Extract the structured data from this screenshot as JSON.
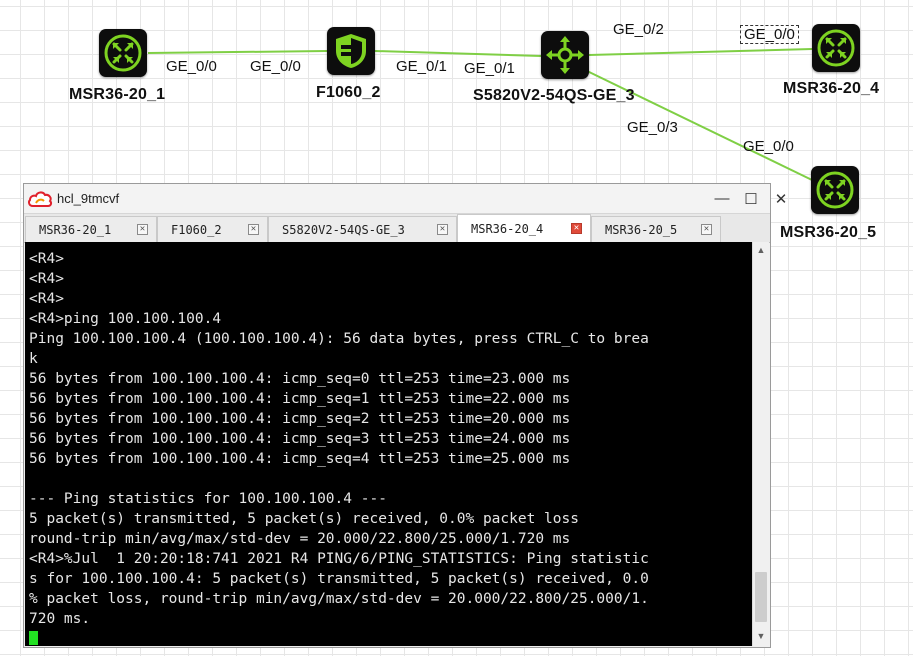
{
  "topology": {
    "devices": {
      "msr1": {
        "label": "MSR36-20_1",
        "icon": "router-icon"
      },
      "fw": {
        "label": "F1060_2",
        "icon": "firewall-shield-icon"
      },
      "sw": {
        "label": "S5820V2-54QS-GE_3",
        "icon": "switch-arrows-icon"
      },
      "msr4": {
        "label": "MSR36-20_4",
        "icon": "router-icon"
      },
      "msr5": {
        "label": "MSR36-20_5",
        "icon": "router-icon"
      }
    },
    "ports": {
      "msr1_fw": "GE_0/0",
      "fw_msr1": "GE_0/0",
      "fw_sw": "GE_0/1",
      "sw_fw": "GE_0/1",
      "sw_msr4": "GE_0/2",
      "msr4_sw": "GE_0/0",
      "sw_msr5": "GE_0/3",
      "msr5_sw": "GE_0/0"
    },
    "link_color": "#7fcf45",
    "icon_color": "#7ed321"
  },
  "window": {
    "title": "hcl_9tmcvf",
    "controls": {
      "minimize": "—",
      "maximize": "☐",
      "close": "✕"
    },
    "tabs": [
      {
        "label": "MSR36-20_1",
        "active": false
      },
      {
        "label": "F1060_2",
        "active": false
      },
      {
        "label": "S5820V2-54QS-GE_3",
        "active": false
      },
      {
        "label": "MSR36-20_4",
        "active": true
      },
      {
        "label": "MSR36-20_5",
        "active": false
      }
    ],
    "terminal_lines": [
      "<R4>",
      "<R4>",
      "<R4>",
      "<R4>ping 100.100.100.4",
      "Ping 100.100.100.4 (100.100.100.4): 56 data bytes, press CTRL_C to brea",
      "k",
      "56 bytes from 100.100.100.4: icmp_seq=0 ttl=253 time=23.000 ms",
      "56 bytes from 100.100.100.4: icmp_seq=1 ttl=253 time=22.000 ms",
      "56 bytes from 100.100.100.4: icmp_seq=2 ttl=253 time=20.000 ms",
      "56 bytes from 100.100.100.4: icmp_seq=3 ttl=253 time=24.000 ms",
      "56 bytes from 100.100.100.4: icmp_seq=4 ttl=253 time=25.000 ms",
      "",
      "--- Ping statistics for 100.100.100.4 ---",
      "5 packet(s) transmitted, 5 packet(s) received, 0.0% packet loss",
      "round-trip min/avg/max/std-dev = 20.000/22.800/25.000/1.720 ms",
      "<R4>%Jul  1 20:20:18:741 2021 R4 PING/6/PING_STATISTICS: Ping statistic",
      "s for 100.100.100.4: 5 packet(s) transmitted, 5 packet(s) received, 0.0",
      "% packet loss, round-trip min/avg/max/std-dev = 20.000/22.800/25.000/1.",
      "720 ms."
    ],
    "cursor_color": "#22e022"
  }
}
